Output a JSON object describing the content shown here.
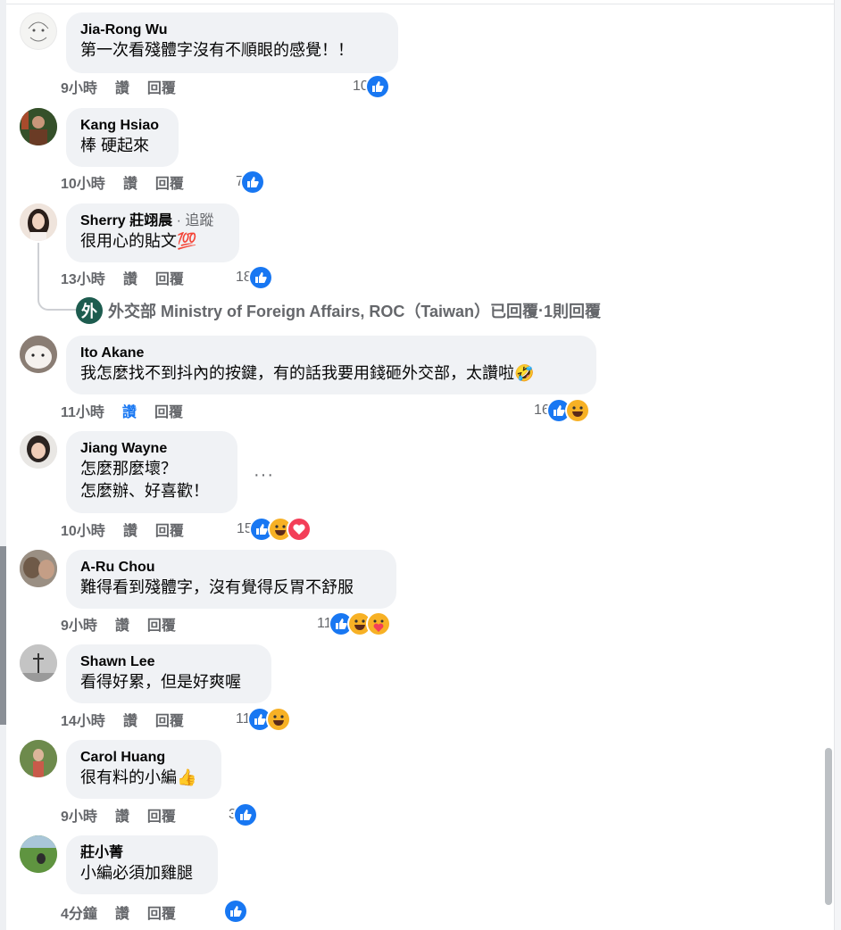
{
  "comments": [
    {
      "author": "Jia-Rong Wu",
      "text": [
        "第一次看殘體字沒有不順眼的感覺！！"
      ],
      "time": "9小時",
      "like": "讚",
      "reply": "回覆",
      "count": "10",
      "reactions": [
        "like-icon"
      ]
    },
    {
      "author": "Kang Hsiao",
      "text": [
        "棒 硬起來"
      ],
      "time": "10小時",
      "like": "讚",
      "reply": "回覆",
      "count": "7",
      "reactions": [
        "like-icon"
      ]
    },
    {
      "author": "Sherry 莊翊晨",
      "follow_sep": " · ",
      "follow": "追蹤",
      "text": [
        "很用心的貼文💯"
      ],
      "time": "13小時",
      "like": "讚",
      "reply": "回覆",
      "count": "18",
      "reactions": [
        "like-icon"
      ]
    },
    {
      "author": "Ito Akane",
      "text": [
        "我怎麼找不到抖內的按鍵，有的話我要用錢砸外交部，太讚啦🤣"
      ],
      "time": "11小時",
      "like": "讚",
      "reply": "回覆",
      "count": "16",
      "reactions": [
        "like-icon",
        "haha-icon"
      ]
    },
    {
      "author": "Jiang Wayne",
      "text": [
        "怎麼那麼壞？",
        "怎麼辦、好喜歡！"
      ],
      "time": "10小時",
      "like": "讚",
      "reply": "回覆",
      "count": "15",
      "reactions": [
        "like-icon",
        "haha-icon",
        "heart-icon"
      ],
      "more": "···"
    },
    {
      "author": "A-Ru Chou",
      "text": [
        "難得看到殘體字，沒有覺得反胃不舒服"
      ],
      "time": "9小時",
      "like": "讚",
      "reply": "回覆",
      "count": "11",
      "reactions": [
        "like-icon",
        "haha-icon",
        "care-icon"
      ]
    },
    {
      "author": "Shawn Lee",
      "text": [
        "看得好累，但是好爽喔"
      ],
      "time": "14小時",
      "like": "讚",
      "reply": "回覆",
      "count": "11",
      "reactions": [
        "like-icon",
        "haha-icon"
      ]
    },
    {
      "author": "Carol Huang",
      "text": [
        "很有料的小編👍"
      ],
      "time": "9小時",
      "like": "讚",
      "reply": "回覆",
      "count": "3",
      "reactions": [
        "like-icon"
      ]
    },
    {
      "author": "莊小菁",
      "text": [
        "小編必須加雞腿"
      ],
      "time": "4分鐘",
      "like": "讚",
      "reply": "回覆",
      "count": "",
      "reactions": [
        "like-icon"
      ]
    }
  ],
  "reply_summary": {
    "logo_char": "外",
    "author": "外交部 Ministry of Foreign Affairs, ROC（Taiwan）",
    "action": "已回覆",
    "sep": " · ",
    "count": "1則回覆"
  },
  "colors": {
    "bubble": "#f0f2f5",
    "secondary_text": "#65676b",
    "accent_blue": "#1877f2",
    "haha_yellow": "#f7b125",
    "heart_red": "#f33e58"
  }
}
